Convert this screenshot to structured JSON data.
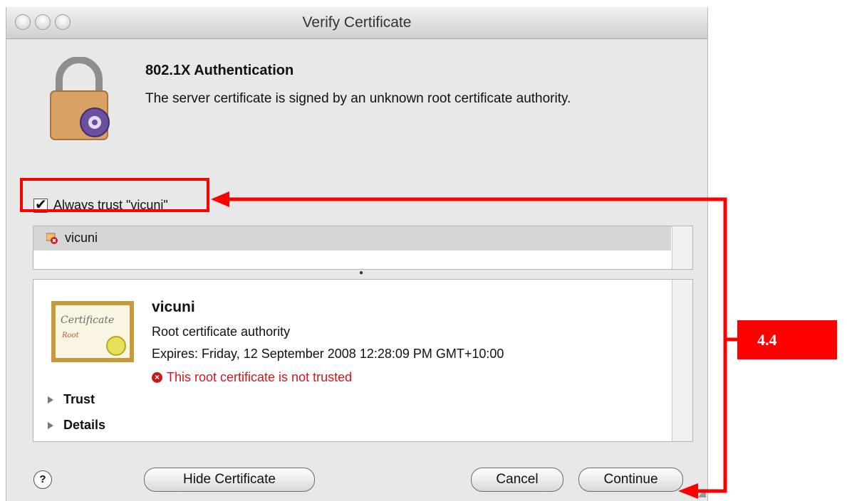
{
  "window": {
    "title": "Verify Certificate"
  },
  "header": {
    "heading": "802.1X Authentication",
    "message": "The server certificate is signed by an unknown root certificate authority."
  },
  "trust_checkbox": {
    "label": "Always trust \"vicuni\"",
    "checked": true
  },
  "cert_list": {
    "items": [
      {
        "label": "vicuni",
        "icon": "certificate-error-icon"
      }
    ]
  },
  "cert_detail": {
    "name": "vicuni",
    "type": "Root certificate authority",
    "expires": "Expires: Friday, 12 September 2008 12:28:09 PM GMT+10:00",
    "status": "This root certificate is not trusted",
    "image_text": {
      "line1": "Certificate",
      "line2": "Root"
    },
    "sections": [
      {
        "label": "Trust"
      },
      {
        "label": "Details"
      }
    ]
  },
  "buttons": {
    "help": "?",
    "hide_certificate": "Hide Certificate",
    "cancel": "Cancel",
    "continue": "Continue"
  },
  "annotation": {
    "label": "4.4"
  },
  "colors": {
    "annotation_red": "#ff0000",
    "status_red": "#d0161b",
    "selection_gray": "#d6d6d6"
  }
}
